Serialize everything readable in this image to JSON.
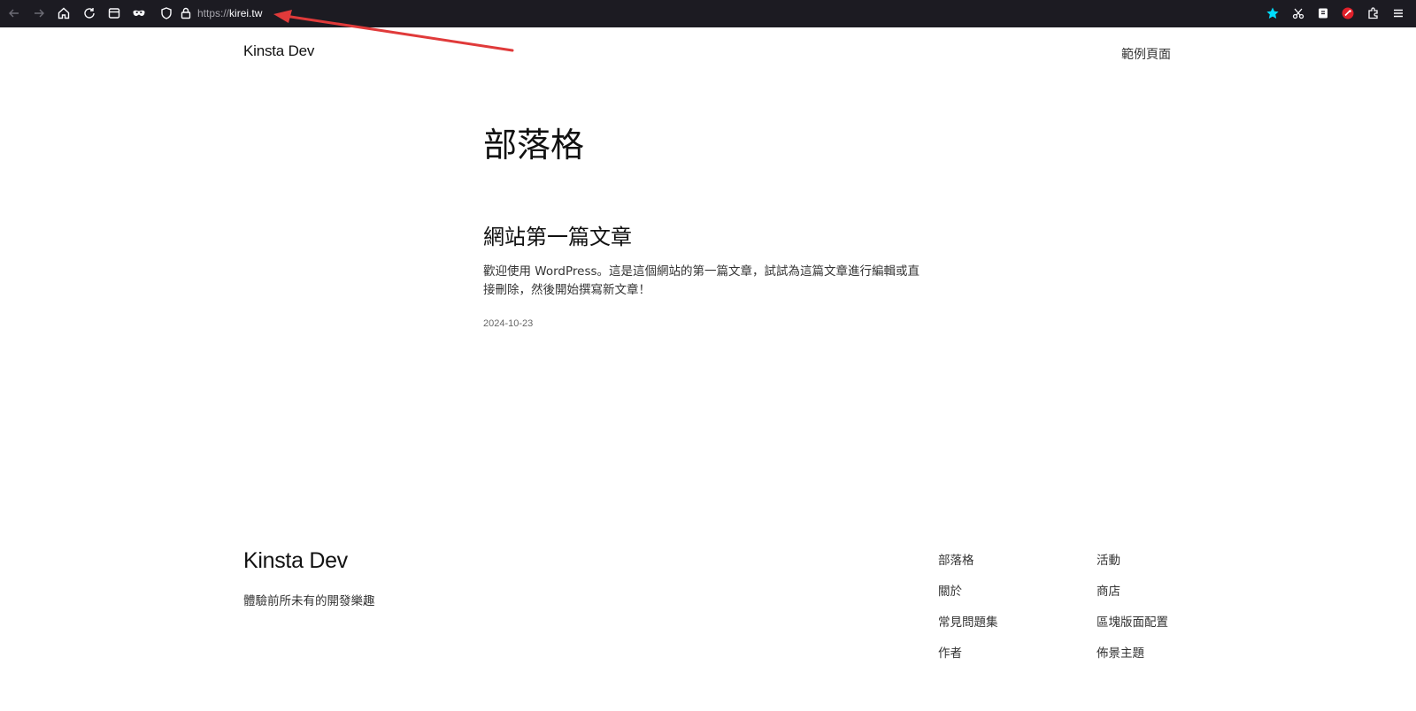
{
  "browser": {
    "url_protocol": "https://",
    "url_host": "kirei.tw",
    "colors": {
      "toolbar_bg": "#1c1b22",
      "bookmark_star": "#00ddff",
      "annotation_arrow": "#e03a3a"
    }
  },
  "header": {
    "site_title": "Kinsta Dev",
    "nav": [
      "範例頁面"
    ]
  },
  "main": {
    "page_title": "部落格",
    "posts": [
      {
        "title": "網站第一篇文章",
        "excerpt": "歡迎使用 WordPress。這是這個網站的第一篇文章，試試為這篇文章進行編輯或直接刪除，然後開始撰寫新文章！",
        "date": "2024-10-23"
      }
    ]
  },
  "footer": {
    "site_title": "Kinsta Dev",
    "tagline": "體驗前所未有的開發樂趣",
    "column_1": [
      "部落格",
      "關於",
      "常見問題集",
      "作者"
    ],
    "column_2": [
      "活動",
      "商店",
      "區塊版面配置",
      "佈景主題"
    ]
  }
}
